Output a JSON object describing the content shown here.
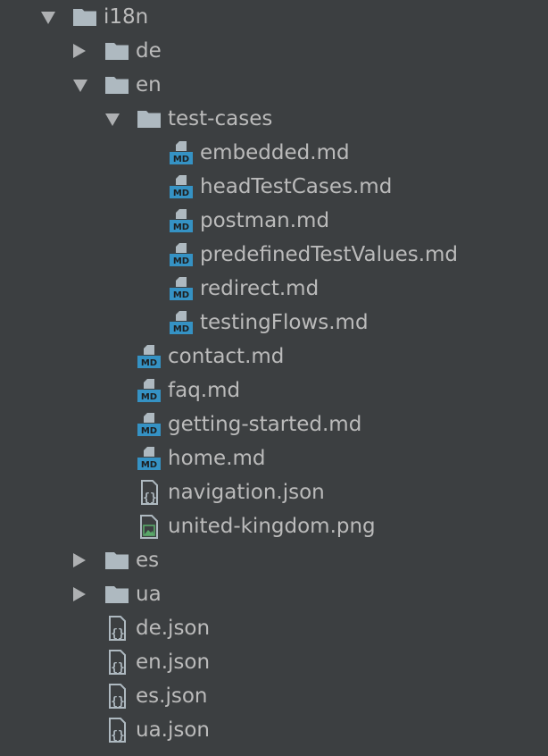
{
  "colors": {
    "background": "#3c3f41",
    "text": "#bbbbbb",
    "arrow": "#aeb0b2",
    "folder": "#aeb9c0",
    "file": "#aeb9c0",
    "md_badge": "#3592c4",
    "image_icon": "#59a869"
  },
  "tree": {
    "items": [
      {
        "label": "i18n",
        "type": "folder",
        "expanded": true,
        "depth": 0,
        "icon": "folder-icon"
      },
      {
        "label": "de",
        "type": "folder",
        "expanded": false,
        "depth": 1,
        "icon": "folder-icon"
      },
      {
        "label": "en",
        "type": "folder",
        "expanded": true,
        "depth": 1,
        "icon": "folder-icon"
      },
      {
        "label": "test-cases",
        "type": "folder",
        "expanded": true,
        "depth": 2,
        "icon": "folder-icon"
      },
      {
        "label": "embedded.md",
        "type": "md",
        "depth": 3,
        "icon": "markdown-file-icon"
      },
      {
        "label": "headTestCases.md",
        "type": "md",
        "depth": 3,
        "icon": "markdown-file-icon"
      },
      {
        "label": "postman.md",
        "type": "md",
        "depth": 3,
        "icon": "markdown-file-icon"
      },
      {
        "label": "predefinedTestValues.md",
        "type": "md",
        "depth": 3,
        "icon": "markdown-file-icon"
      },
      {
        "label": "redirect.md",
        "type": "md",
        "depth": 3,
        "icon": "markdown-file-icon"
      },
      {
        "label": "testingFlows.md",
        "type": "md",
        "depth": 3,
        "icon": "markdown-file-icon"
      },
      {
        "label": "contact.md",
        "type": "md",
        "depth": 2,
        "icon": "markdown-file-icon"
      },
      {
        "label": "faq.md",
        "type": "md",
        "depth": 2,
        "icon": "markdown-file-icon"
      },
      {
        "label": "getting-started.md",
        "type": "md",
        "depth": 2,
        "icon": "markdown-file-icon"
      },
      {
        "label": "home.md",
        "type": "md",
        "depth": 2,
        "icon": "markdown-file-icon"
      },
      {
        "label": "navigation.json",
        "type": "json",
        "depth": 2,
        "icon": "json-file-icon"
      },
      {
        "label": "united-kingdom.png",
        "type": "image",
        "depth": 2,
        "icon": "image-file-icon"
      },
      {
        "label": "es",
        "type": "folder",
        "expanded": false,
        "depth": 1,
        "icon": "folder-icon"
      },
      {
        "label": "ua",
        "type": "folder",
        "expanded": false,
        "depth": 1,
        "icon": "folder-icon"
      },
      {
        "label": "de.json",
        "type": "json",
        "depth": 1,
        "icon": "json-file-icon"
      },
      {
        "label": "en.json",
        "type": "json",
        "depth": 1,
        "icon": "json-file-icon"
      },
      {
        "label": "es.json",
        "type": "json",
        "depth": 1,
        "icon": "json-file-icon"
      },
      {
        "label": "ua.json",
        "type": "json",
        "depth": 1,
        "icon": "json-file-icon"
      }
    ]
  }
}
